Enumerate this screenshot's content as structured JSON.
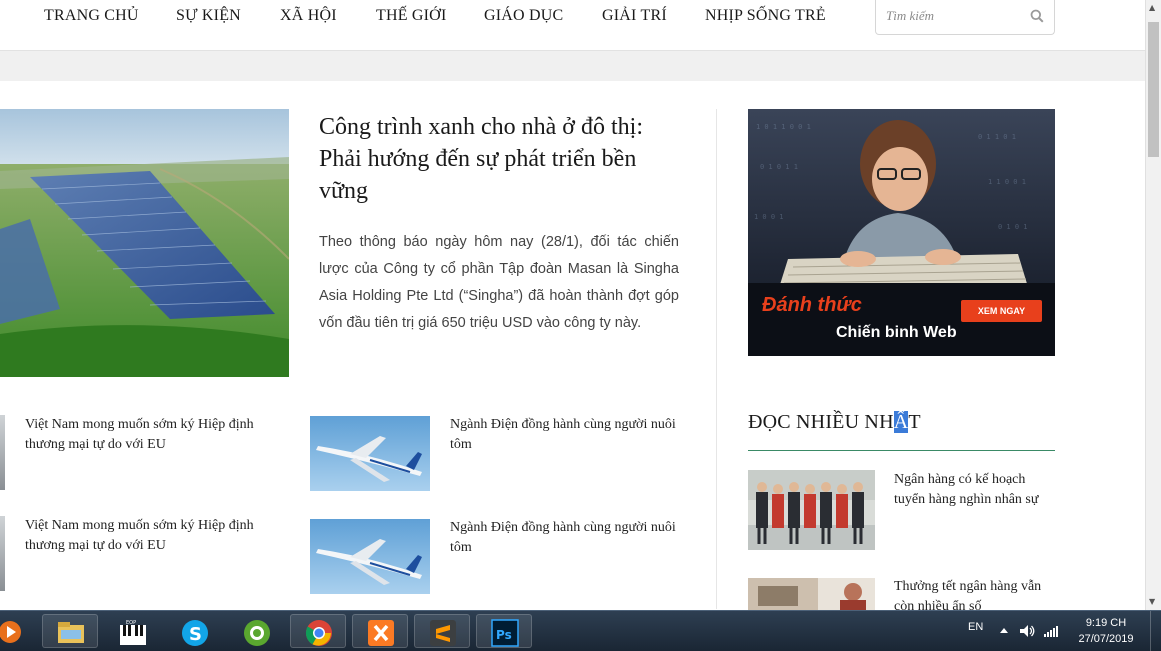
{
  "nav": {
    "items": [
      "TRANG CHỦ",
      "SỰ KIỆN",
      "XÃ HỘI",
      "THẾ GIỚI",
      "GIÁO DỤC",
      "GIẢI TRÍ",
      "NHỊP SỐNG TRẺ"
    ],
    "search_placeholder": "Tìm kiếm"
  },
  "featured": {
    "title": "Công trình xanh cho nhà ở đô thị: Phải hướng đến sự phát triển bền vững",
    "description": "Theo thông báo ngày hôm nay (28/1), đối tác chiến lược của Công ty cổ phần Tập đoàn Masan là Singha Asia Holding Pte Ltd (“Singha”) đã hoàn thành đợt góp vốn đầu tiên trị giá 650 triệu USD vào công ty này."
  },
  "articles": [
    {
      "title": "Việt Nam mong muốn sớm ký Hiệp định thương mại tự do với EU"
    },
    {
      "title": "Ngành Điện đồng hành cùng người nuôi tôm"
    },
    {
      "title": "Việt Nam mong muốn sớm ký Hiệp định thương mại tự do với EU"
    },
    {
      "title": "Ngành Điện đồng hành cùng người nuôi tôm"
    }
  ],
  "ad": {
    "line1": "Đánh thức",
    "line2": "Chiến binh Web",
    "cta": "XEM NGAY"
  },
  "sidebar": {
    "heading_before": "ĐỌC NHIỀU NH",
    "heading_selected": "Ấ",
    "heading_after": "T",
    "items": [
      {
        "title": "Ngân hàng có kế hoạch tuyển hàng nghìn nhân sự"
      },
      {
        "title": "Thưởng tết ngân hàng vẫn còn nhiều ẩn số"
      }
    ]
  },
  "taskbar": {
    "apps": [
      "media-player-icon",
      "file-explorer-icon",
      "eop-piano-icon",
      "skype-icon",
      "coc-coc-browser-icon",
      "chrome-icon",
      "xampp-icon",
      "sublime-text-icon",
      "photoshop-icon"
    ],
    "language": "EN",
    "time": "9:19 CH",
    "date": "27/07/2019"
  },
  "colors": {
    "accent_rule": "#3a8a66",
    "ad_cta": "#e8401c",
    "selection": "#3b7bd8"
  }
}
